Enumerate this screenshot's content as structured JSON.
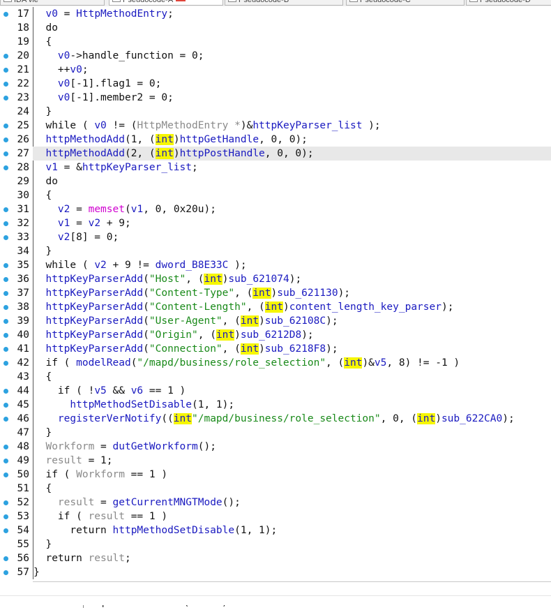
{
  "tabs": [
    {
      "label": "IDA vie",
      "active": false
    },
    {
      "label": "Pseudocode-A",
      "active": true
    },
    {
      "label": "Pseudocode-B",
      "active": false
    },
    {
      "label": "Pseudocode-C",
      "active": false
    },
    {
      "label": "Pseudocode-D",
      "active": false
    }
  ],
  "current_line": 27,
  "lines": [
    {
      "n": "17",
      "dot": true,
      "tokens": [
        [
          "p",
          "  "
        ],
        [
          "v",
          "v0"
        ],
        [
          "p",
          " = "
        ],
        [
          "f",
          "HttpMethodEntry"
        ],
        [
          "p",
          ";"
        ]
      ]
    },
    {
      "n": "18",
      "dot": false,
      "tokens": [
        [
          "p",
          "  do"
        ]
      ]
    },
    {
      "n": "19",
      "dot": false,
      "tokens": [
        [
          "p",
          "  {"
        ]
      ]
    },
    {
      "n": "20",
      "dot": true,
      "tokens": [
        [
          "p",
          "    "
        ],
        [
          "v",
          "v0"
        ],
        [
          "p",
          "->handle_function = 0;"
        ]
      ]
    },
    {
      "n": "21",
      "dot": true,
      "tokens": [
        [
          "p",
          "    ++"
        ],
        [
          "v",
          "v0"
        ],
        [
          "p",
          ";"
        ]
      ]
    },
    {
      "n": "22",
      "dot": true,
      "tokens": [
        [
          "p",
          "    "
        ],
        [
          "v",
          "v0"
        ],
        [
          "p",
          "[-1].flag1 = 0;"
        ]
      ]
    },
    {
      "n": "23",
      "dot": true,
      "tokens": [
        [
          "p",
          "    "
        ],
        [
          "v",
          "v0"
        ],
        [
          "p",
          "[-1].member2 = 0;"
        ]
      ]
    },
    {
      "n": "24",
      "dot": false,
      "tokens": [
        [
          "p",
          "  }"
        ]
      ]
    },
    {
      "n": "25",
      "dot": true,
      "tokens": [
        [
          "p",
          "  while ( "
        ],
        [
          "v",
          "v0"
        ],
        [
          "p",
          " != ("
        ],
        [
          "d",
          "HttpMethodEntry *"
        ],
        [
          "p",
          ")&"
        ],
        [
          "g",
          "httpKeyParser_list"
        ],
        [
          "p",
          " );"
        ]
      ]
    },
    {
      "n": "26",
      "dot": true,
      "tokens": [
        [
          "p",
          "  "
        ],
        [
          "f",
          "httpMethodAdd"
        ],
        [
          "p",
          "(1, ("
        ],
        [
          "h",
          "int"
        ],
        [
          "p",
          ")"
        ],
        [
          "f",
          "httpGetHandle"
        ],
        [
          "p",
          ", 0, 0);"
        ]
      ]
    },
    {
      "n": "27",
      "dot": true,
      "tokens": [
        [
          "p",
          "  "
        ],
        [
          "f",
          "httpMethodAdd"
        ],
        [
          "p",
          "(2, ("
        ],
        [
          "h",
          "int"
        ],
        [
          "p",
          ")"
        ],
        [
          "f",
          "httpPostHandle"
        ],
        [
          "p",
          ", 0, 0);"
        ]
      ]
    },
    {
      "n": "28",
      "dot": true,
      "tokens": [
        [
          "p",
          "  "
        ],
        [
          "v",
          "v1"
        ],
        [
          "p",
          " = &"
        ],
        [
          "g",
          "httpKeyParser_list"
        ],
        [
          "p",
          ";"
        ]
      ]
    },
    {
      "n": "29",
      "dot": false,
      "tokens": [
        [
          "p",
          "  do"
        ]
      ]
    },
    {
      "n": "30",
      "dot": false,
      "tokens": [
        [
          "p",
          "  {"
        ]
      ]
    },
    {
      "n": "31",
      "dot": true,
      "tokens": [
        [
          "p",
          "    "
        ],
        [
          "v",
          "v2"
        ],
        [
          "p",
          " = "
        ],
        [
          "l",
          "memset"
        ],
        [
          "p",
          "("
        ],
        [
          "v",
          "v1"
        ],
        [
          "p",
          ", 0, 0x20u);"
        ]
      ]
    },
    {
      "n": "32",
      "dot": true,
      "tokens": [
        [
          "p",
          "    "
        ],
        [
          "v",
          "v1"
        ],
        [
          "p",
          " = "
        ],
        [
          "v",
          "v2"
        ],
        [
          "p",
          " + 9;"
        ]
      ]
    },
    {
      "n": "33",
      "dot": true,
      "tokens": [
        [
          "p",
          "    "
        ],
        [
          "v",
          "v2"
        ],
        [
          "p",
          "[8] = 0;"
        ]
      ]
    },
    {
      "n": "34",
      "dot": false,
      "tokens": [
        [
          "p",
          "  }"
        ]
      ]
    },
    {
      "n": "35",
      "dot": true,
      "tokens": [
        [
          "p",
          "  while ( "
        ],
        [
          "v",
          "v2"
        ],
        [
          "p",
          " + 9 != "
        ],
        [
          "g",
          "dword_B8E33C"
        ],
        [
          "p",
          " );"
        ]
      ]
    },
    {
      "n": "36",
      "dot": true,
      "tokens": [
        [
          "p",
          "  "
        ],
        [
          "f",
          "httpKeyParserAdd"
        ],
        [
          "p",
          "("
        ],
        [
          "s",
          "\"Host\""
        ],
        [
          "p",
          ", ("
        ],
        [
          "h",
          "int"
        ],
        [
          "p",
          ")"
        ],
        [
          "f",
          "sub_621074"
        ],
        [
          "p",
          ");"
        ]
      ]
    },
    {
      "n": "37",
      "dot": true,
      "tokens": [
        [
          "p",
          "  "
        ],
        [
          "f",
          "httpKeyParserAdd"
        ],
        [
          "p",
          "("
        ],
        [
          "s",
          "\"Content-Type\""
        ],
        [
          "p",
          ", ("
        ],
        [
          "h",
          "int"
        ],
        [
          "p",
          ")"
        ],
        [
          "f",
          "sub_621130"
        ],
        [
          "p",
          ");"
        ]
      ]
    },
    {
      "n": "38",
      "dot": true,
      "tokens": [
        [
          "p",
          "  "
        ],
        [
          "f",
          "httpKeyParserAdd"
        ],
        [
          "p",
          "("
        ],
        [
          "s",
          "\"Content-Length\""
        ],
        [
          "p",
          ", ("
        ],
        [
          "h",
          "int"
        ],
        [
          "p",
          ")"
        ],
        [
          "f",
          "content_length_key_parser"
        ],
        [
          "p",
          ");"
        ]
      ]
    },
    {
      "n": "39",
      "dot": true,
      "tokens": [
        [
          "p",
          "  "
        ],
        [
          "f",
          "httpKeyParserAdd"
        ],
        [
          "p",
          "("
        ],
        [
          "s",
          "\"User-Agent\""
        ],
        [
          "p",
          ", ("
        ],
        [
          "h",
          "int"
        ],
        [
          "p",
          ")"
        ],
        [
          "f",
          "sub_62108C"
        ],
        [
          "p",
          ");"
        ]
      ]
    },
    {
      "n": "40",
      "dot": true,
      "tokens": [
        [
          "p",
          "  "
        ],
        [
          "f",
          "httpKeyParserAdd"
        ],
        [
          "p",
          "("
        ],
        [
          "s",
          "\"Origin\""
        ],
        [
          "p",
          ", ("
        ],
        [
          "h",
          "int"
        ],
        [
          "p",
          ")"
        ],
        [
          "f",
          "sub_6212D8"
        ],
        [
          "p",
          ");"
        ]
      ]
    },
    {
      "n": "41",
      "dot": true,
      "tokens": [
        [
          "p",
          "  "
        ],
        [
          "f",
          "httpKeyParserAdd"
        ],
        [
          "p",
          "("
        ],
        [
          "s",
          "\"Connection\""
        ],
        [
          "p",
          ", ("
        ],
        [
          "h",
          "int"
        ],
        [
          "p",
          ")"
        ],
        [
          "f",
          "sub_6218F8"
        ],
        [
          "p",
          ");"
        ]
      ]
    },
    {
      "n": "42",
      "dot": true,
      "tokens": [
        [
          "p",
          "  if ( "
        ],
        [
          "f",
          "modelRead"
        ],
        [
          "p",
          "("
        ],
        [
          "s",
          "\"/mapd/business/role_selection\""
        ],
        [
          "p",
          ", ("
        ],
        [
          "h",
          "int"
        ],
        [
          "p",
          ")&"
        ],
        [
          "v",
          "v5"
        ],
        [
          "p",
          ", 8) != -1 )"
        ]
      ]
    },
    {
      "n": "43",
      "dot": false,
      "tokens": [
        [
          "p",
          "  {"
        ]
      ]
    },
    {
      "n": "44",
      "dot": true,
      "tokens": [
        [
          "p",
          "    if ( !"
        ],
        [
          "v",
          "v5"
        ],
        [
          "p",
          " && "
        ],
        [
          "v",
          "v6"
        ],
        [
          "p",
          " == 1 )"
        ]
      ]
    },
    {
      "n": "45",
      "dot": true,
      "tokens": [
        [
          "p",
          "      "
        ],
        [
          "f",
          "httpMethodSetDisable"
        ],
        [
          "p",
          "(1, 1);"
        ]
      ]
    },
    {
      "n": "46",
      "dot": true,
      "tokens": [
        [
          "p",
          "    "
        ],
        [
          "f",
          "registerVerNotify"
        ],
        [
          "p",
          "(("
        ],
        [
          "h",
          "int"
        ],
        [
          "s",
          "\"/mapd/business/role_selection\""
        ],
        [
          "p",
          ", 0, ("
        ],
        [
          "h",
          "int"
        ],
        [
          "p",
          ")"
        ],
        [
          "f",
          "sub_622CA0"
        ],
        [
          "p",
          ");"
        ]
      ]
    },
    {
      "n": "47",
      "dot": false,
      "tokens": [
        [
          "p",
          "  }"
        ]
      ]
    },
    {
      "n": "48",
      "dot": true,
      "tokens": [
        [
          "p",
          "  "
        ],
        [
          "d",
          "Workform"
        ],
        [
          "p",
          " = "
        ],
        [
          "f",
          "dutGetWorkform"
        ],
        [
          "p",
          "();"
        ]
      ]
    },
    {
      "n": "49",
      "dot": true,
      "tokens": [
        [
          "p",
          "  "
        ],
        [
          "d",
          "result"
        ],
        [
          "p",
          " = 1;"
        ]
      ]
    },
    {
      "n": "50",
      "dot": true,
      "tokens": [
        [
          "p",
          "  if ( "
        ],
        [
          "d",
          "Workform"
        ],
        [
          "p",
          " == 1 )"
        ]
      ]
    },
    {
      "n": "51",
      "dot": false,
      "tokens": [
        [
          "p",
          "  {"
        ]
      ]
    },
    {
      "n": "52",
      "dot": true,
      "tokens": [
        [
          "p",
          "    "
        ],
        [
          "d",
          "result"
        ],
        [
          "p",
          " = "
        ],
        [
          "f",
          "getCurrentMNGTMode"
        ],
        [
          "p",
          "();"
        ]
      ]
    },
    {
      "n": "53",
      "dot": true,
      "tokens": [
        [
          "p",
          "    if ( "
        ],
        [
          "d",
          "result"
        ],
        [
          "p",
          " == 1 )"
        ]
      ]
    },
    {
      "n": "54",
      "dot": true,
      "tokens": [
        [
          "p",
          "      return "
        ],
        [
          "f",
          "httpMethodSetDisable"
        ],
        [
          "p",
          "(1, 1);"
        ]
      ]
    },
    {
      "n": "55",
      "dot": false,
      "tokens": [
        [
          "p",
          "  }"
        ]
      ]
    },
    {
      "n": "56",
      "dot": true,
      "tokens": [
        [
          "p",
          "  return "
        ],
        [
          "d",
          "result"
        ],
        [
          "p",
          ";"
        ]
      ]
    },
    {
      "n": "57",
      "dot": true,
      "tokens": [
        [
          "p",
          "}"
        ]
      ]
    }
  ],
  "status": {
    "type": "UNKNOWN",
    "location": "httpParserInit:27 (625DF8)"
  }
}
